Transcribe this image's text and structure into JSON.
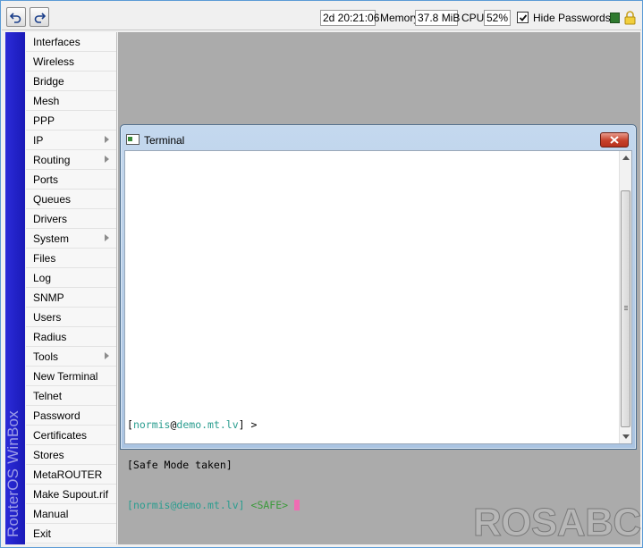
{
  "toolbar": {
    "undo_icon": "undo-arrow",
    "redo_icon": "redo-arrow",
    "uptime": "2d 20:21:06",
    "memory_label": "Memory:",
    "memory_value": "37.8 MiB",
    "cpu_label": "CPU:",
    "cpu_value": "52%",
    "hide_passwords_label": "Hide Passwords",
    "hide_passwords_checked": true
  },
  "sidebar": {
    "brand": "RouterOS WinBox",
    "items": [
      {
        "label": "Interfaces",
        "submenu": false
      },
      {
        "label": "Wireless",
        "submenu": false
      },
      {
        "label": "Bridge",
        "submenu": false
      },
      {
        "label": "Mesh",
        "submenu": false
      },
      {
        "label": "PPP",
        "submenu": false
      },
      {
        "label": "IP",
        "submenu": true
      },
      {
        "label": "Routing",
        "submenu": true
      },
      {
        "label": "Ports",
        "submenu": false
      },
      {
        "label": "Queues",
        "submenu": false
      },
      {
        "label": "Drivers",
        "submenu": false
      },
      {
        "label": "System",
        "submenu": true
      },
      {
        "label": "Files",
        "submenu": false
      },
      {
        "label": "Log",
        "submenu": false
      },
      {
        "label": "SNMP",
        "submenu": false
      },
      {
        "label": "Users",
        "submenu": false
      },
      {
        "label": "Radius",
        "submenu": false
      },
      {
        "label": "Tools",
        "submenu": true
      },
      {
        "label": "New Terminal",
        "submenu": false
      },
      {
        "label": "Telnet",
        "submenu": false
      },
      {
        "label": "Password",
        "submenu": false
      },
      {
        "label": "Certificates",
        "submenu": false
      },
      {
        "label": "Stores",
        "submenu": false
      },
      {
        "label": "MetaROUTER",
        "submenu": false
      },
      {
        "label": "Make Supout.rif",
        "submenu": false
      },
      {
        "label": "Manual",
        "submenu": false
      },
      {
        "label": "Exit",
        "submenu": false
      }
    ]
  },
  "terminal": {
    "title": "Terminal",
    "lines": [
      {
        "user": "normis",
        "at": "@",
        "host": "demo.mt.lv",
        "suffix": " >"
      },
      {
        "text": "[Safe Mode taken]"
      },
      {
        "user": "normis",
        "at": "@",
        "host": "demo.mt.lv",
        "suffix": " <SAFE>"
      }
    ]
  },
  "watermark": "ROSABC",
  "colors": {
    "sidebar_strip": "#2323c8",
    "desktop": "#ababab",
    "terminal_prompt": "#2a9d8f",
    "cursor": "#f06cb3"
  }
}
